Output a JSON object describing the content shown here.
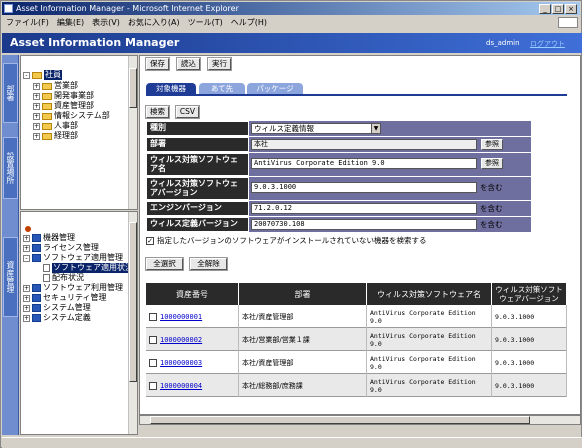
{
  "window": {
    "title": "Asset Information Manager - Microsoft Internet Explorer"
  },
  "menu": [
    "ファイル(F)",
    "編集(E)",
    "表示(V)",
    "お気に入り(A)",
    "ツール(T)",
    "ヘルプ(H)"
  ],
  "app": {
    "title": "Asset Information Manager",
    "user": "ds_admin",
    "logout": "ログアウト"
  },
  "sidetabs": {
    "top": "部署",
    "middle": "設置場所",
    "bottom": "資産管理"
  },
  "org_tree": {
    "root": "社員",
    "children": [
      "営業部",
      "開発事業部",
      "資産管理部",
      "情報システム部",
      "人事部",
      "経理部"
    ]
  },
  "func_tree": {
    "items": [
      {
        "label": "機器管理",
        "sign": "+"
      },
      {
        "label": "ライセンス管理",
        "sign": "+"
      },
      {
        "label": "ソフトウェア適用管理",
        "sign": "-"
      },
      {
        "label": "ソフトウェア適用状況",
        "sign": ""
      },
      {
        "label": "配布状況",
        "sign": ""
      },
      {
        "label": "ソフトウェア利用管理",
        "sign": "+"
      },
      {
        "label": "セキュリティ管理",
        "sign": "+"
      },
      {
        "label": "システム管理",
        "sign": "+"
      },
      {
        "label": "システム定義",
        "sign": "+"
      }
    ]
  },
  "toolbar": {
    "save": "保存",
    "read": "読込",
    "run": "実行"
  },
  "tabs": [
    "対象機器",
    "あて先",
    "パッケージ"
  ],
  "search_buttons": {
    "search": "検索",
    "csv": "CSV"
  },
  "form": {
    "type_label": "種別",
    "type_value": "ウィルス定義情報",
    "dept_label": "部署",
    "dept_value": "本社",
    "browse": "参照",
    "software_name_label": "ウィルス対策ソフトウェア名",
    "software_name_value": "AntiVirus Corporate Edition 9.0",
    "software_version_label": "ウィルス対策ソフトウェアバージョン",
    "software_version_value": "9.0.3.1000",
    "engine_version_label": "エンジンバージョン",
    "engine_version_value": "71.2.0.12",
    "def_version_label": "ウィルス定義バージョン",
    "def_version_value": "20070730.108",
    "include_suffix": "を含む"
  },
  "filter_checkbox": {
    "label": "指定したバージョンのソフトウェアがインストールされていない機器を検索する",
    "checked": true
  },
  "select_buttons": {
    "select_all": "全選択",
    "deselect_all": "全解除"
  },
  "table": {
    "headers": [
      "資産番号",
      "部署",
      "ウィルス対策ソフトウェア名",
      "ウィルス対策ソフトウェアバージョン"
    ],
    "rows": [
      {
        "id": "1000000001",
        "dept": "本社/資産管理部",
        "software": "AntiVirus Corporate Edition 9.0",
        "version": "9.0.3.1000"
      },
      {
        "id": "1000000002",
        "dept": "本社/営業部/営業１課",
        "software": "AntiVirus Corporate Edition 9.0",
        "version": "9.0.3.1000"
      },
      {
        "id": "1000000003",
        "dept": "本社/資産管理部",
        "software": "AntiVirus Corporate Edition 9.0",
        "version": "9.0.3.1000"
      },
      {
        "id": "1000000004",
        "dept": "本社/総務部/庶務課",
        "software": "AntiVirus Corporate Edition 9.0",
        "version": "9.0.3.1000"
      }
    ]
  }
}
